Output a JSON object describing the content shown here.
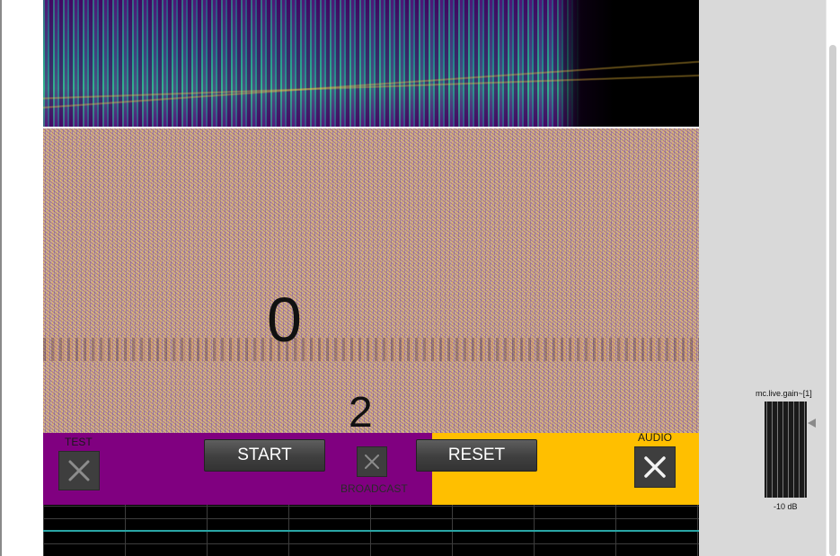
{
  "display": {
    "big_number": "0",
    "small_number": "2"
  },
  "controls": {
    "test_label": "TEST",
    "start_label": "START",
    "broadcast_label": "BROADCAST",
    "reset_label": "RESET",
    "audio_label": "AUDIO"
  },
  "gain": {
    "object_name": "mc.live.gain~[1]",
    "value_text": "-10 dB"
  },
  "colors": {
    "left_panel": "#800080",
    "right_panel": "#ffbf00",
    "scope_trace": "#2aa6a6"
  },
  "icons": {
    "toggle": "close-x-icon"
  }
}
